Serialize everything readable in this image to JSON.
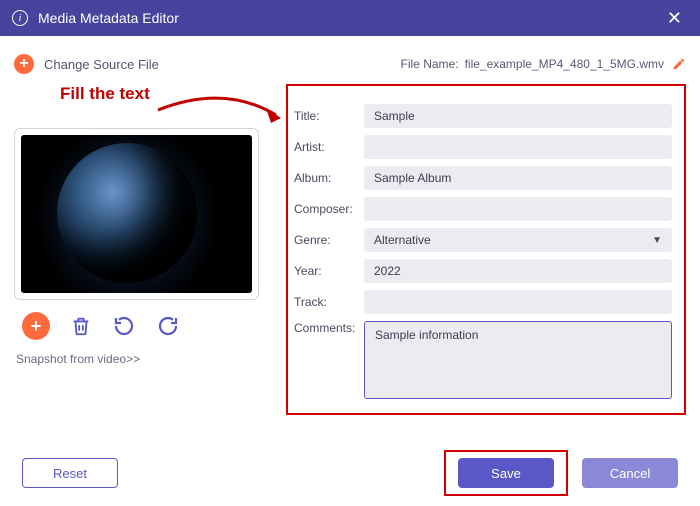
{
  "titlebar": {
    "title": "Media Metadata Editor"
  },
  "topbar": {
    "change_source": "Change Source File",
    "file_name_label": "File Name:",
    "file_name_value": "file_example_MP4_480_1_5MG.wmv"
  },
  "annotation": {
    "fill_text": "Fill the text"
  },
  "left": {
    "snapshot_link": "Snapshot from video>>"
  },
  "fields": {
    "title_label": "Title:",
    "title_value": "Sample",
    "artist_label": "Artist:",
    "artist_value": "",
    "album_label": "Album:",
    "album_value": "Sample Album",
    "composer_label": "Composer:",
    "composer_value": "",
    "genre_label": "Genre:",
    "genre_value": "Alternative",
    "year_label": "Year:",
    "year_value": "2022",
    "track_label": "Track:",
    "track_value": "",
    "comments_label": "Comments:",
    "comments_value": "Sample information"
  },
  "footer": {
    "reset": "Reset",
    "save": "Save",
    "cancel": "Cancel"
  }
}
